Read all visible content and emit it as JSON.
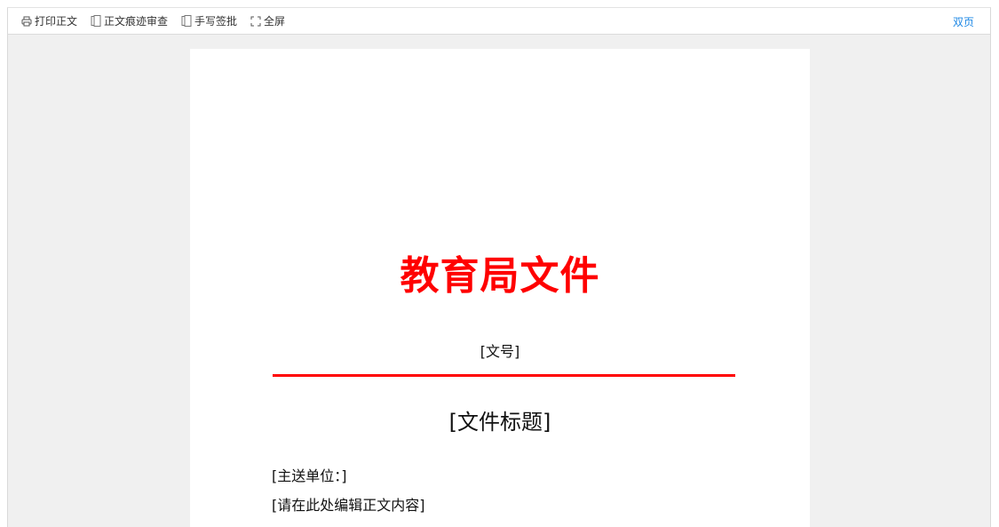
{
  "toolbar": {
    "print_label": "打印正文",
    "track_label": "正文痕迹审查",
    "sign_label": "手写签批",
    "fullscreen_label": "全屏",
    "double_page_label": "双页"
  },
  "document": {
    "org_header": "教育局文件",
    "doc_number": "[文号]",
    "title": "[文件标题]",
    "recipient": "[主送单位：]",
    "body_placeholder": "[请在此处编辑正文内容]"
  },
  "colors": {
    "header_red": "#ff0000",
    "link_blue": "#1e88e5",
    "background": "#f0f0f0"
  },
  "icons": {
    "print": "printer-icon",
    "track": "document-pages-icon",
    "sign": "document-pages-icon",
    "fullscreen": "fullscreen-icon"
  }
}
